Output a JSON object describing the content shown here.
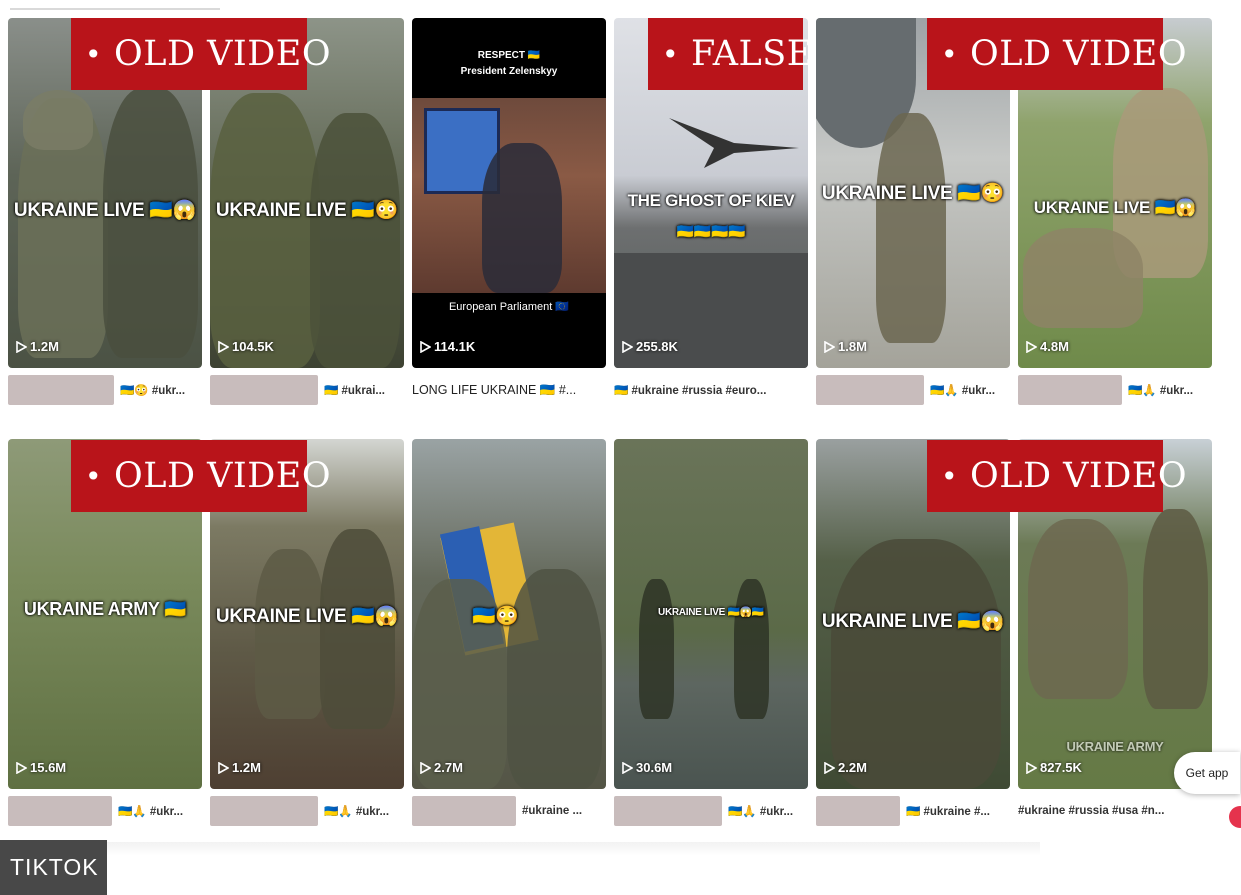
{
  "banners": {
    "old_video_label": "OLD VIDEO",
    "false_label": "FALSE",
    "bullet": "•"
  },
  "row1": [
    {
      "overlay": "UKRAINE LIVE 🇺🇦😱",
      "views": "1.2M",
      "desc_redacted": true,
      "desc": "🇺🇦😳 #ukr..."
    },
    {
      "overlay": "UKRAINE LIVE 🇺🇦😳",
      "views": "104.5K",
      "desc_redacted": true,
      "desc": "🇺🇦 #ukrai..."
    },
    {
      "overlay": "",
      "top_text_1": "RESPECT 🇺🇦",
      "top_text_2": "President Zelenskyy",
      "bottom_text": "European Parliament 🇪🇺",
      "views": "114.1K",
      "desc_redacted": false,
      "desc": "LONG LIFE UKRAINE 🇺🇦 #..."
    },
    {
      "overlay": "THE GHOST OF KIEV",
      "overlay_sub": "🇺🇦🇺🇦🇺🇦🇺🇦",
      "views": "255.8K",
      "desc_redacted": false,
      "desc": "🇺🇦 #ukraine #russia #euro..."
    },
    {
      "overlay": "UKRAINE LIVE 🇺🇦😳",
      "views": "1.8M",
      "desc_redacted": true,
      "desc": "🇺🇦🙏 #ukr..."
    },
    {
      "overlay": "UKRAINE LIVE 🇺🇦😱",
      "views": "4.8M",
      "desc_redacted": true,
      "desc": "🇺🇦🙏 #ukr..."
    }
  ],
  "row2": [
    {
      "overlay": "UKRAINE ARMY 🇺🇦",
      "views": "15.6M",
      "desc_redacted": true,
      "desc": "🇺🇦🙏 #ukr..."
    },
    {
      "overlay": "UKRAINE LIVE 🇺🇦😱",
      "views": "1.2M",
      "desc_redacted": true,
      "desc": "🇺🇦🙏 #ukr..."
    },
    {
      "overlay": "🇺🇦😳",
      "views": "2.7M",
      "desc_redacted": true,
      "desc": "#ukraine ..."
    },
    {
      "overlay": "UKRAINE LIVE 🇺🇦😱🇺🇦",
      "views": "30.6M",
      "desc_redacted": true,
      "desc": "🇺🇦🙏 #ukr..."
    },
    {
      "overlay": "UKRAINE LIVE 🇺🇦😱",
      "views": "2.2M",
      "desc_redacted": true,
      "desc": "🇺🇦 #ukraine #..."
    },
    {
      "overlay": "UKRAINE ARMY",
      "views": "827.5K",
      "desc_redacted": false,
      "desc": "#ukraine #russia #usa #n..."
    }
  ],
  "get_app_label": "Get app",
  "source_tag": "TIKTOK",
  "colors": {
    "banner_red": "#b9141a",
    "redaction": "#c8bcbc",
    "source_tag_bg": "#484848"
  }
}
